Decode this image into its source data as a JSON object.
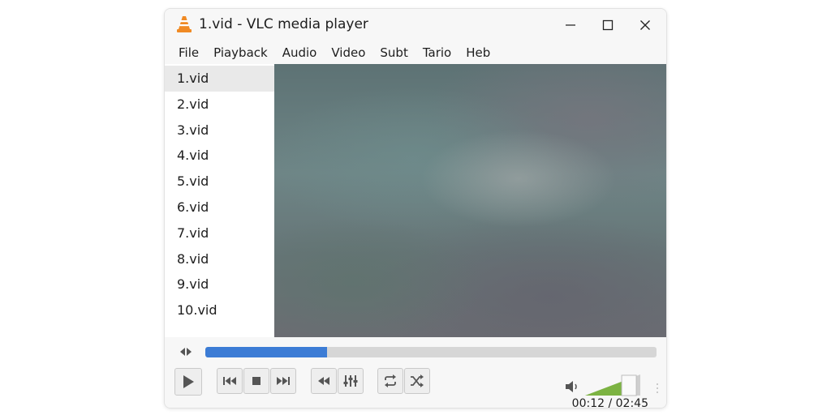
{
  "window": {
    "title": "1.vid - VLC media player"
  },
  "menu": [
    "File",
    "Piayback",
    "Audio",
    "Video",
    "Subt",
    "Tario",
    "Heb"
  ],
  "playlist": {
    "selected_index": 0,
    "items": [
      "1.vid",
      "2.vid",
      "3.vid",
      "4.vid",
      "5.vid",
      "6.vid",
      "7.vid",
      "8.vid",
      "9.vid",
      "10.vid"
    ]
  },
  "playback": {
    "progress_fraction": 0.27,
    "current_time": "00:12",
    "separator": "/",
    "total_time": "02:45",
    "volume_fraction": 0.85
  },
  "colors": {
    "accent": "#3c7cd5",
    "volume": "#7cb342",
    "vlc_orange": "#f08a24"
  }
}
